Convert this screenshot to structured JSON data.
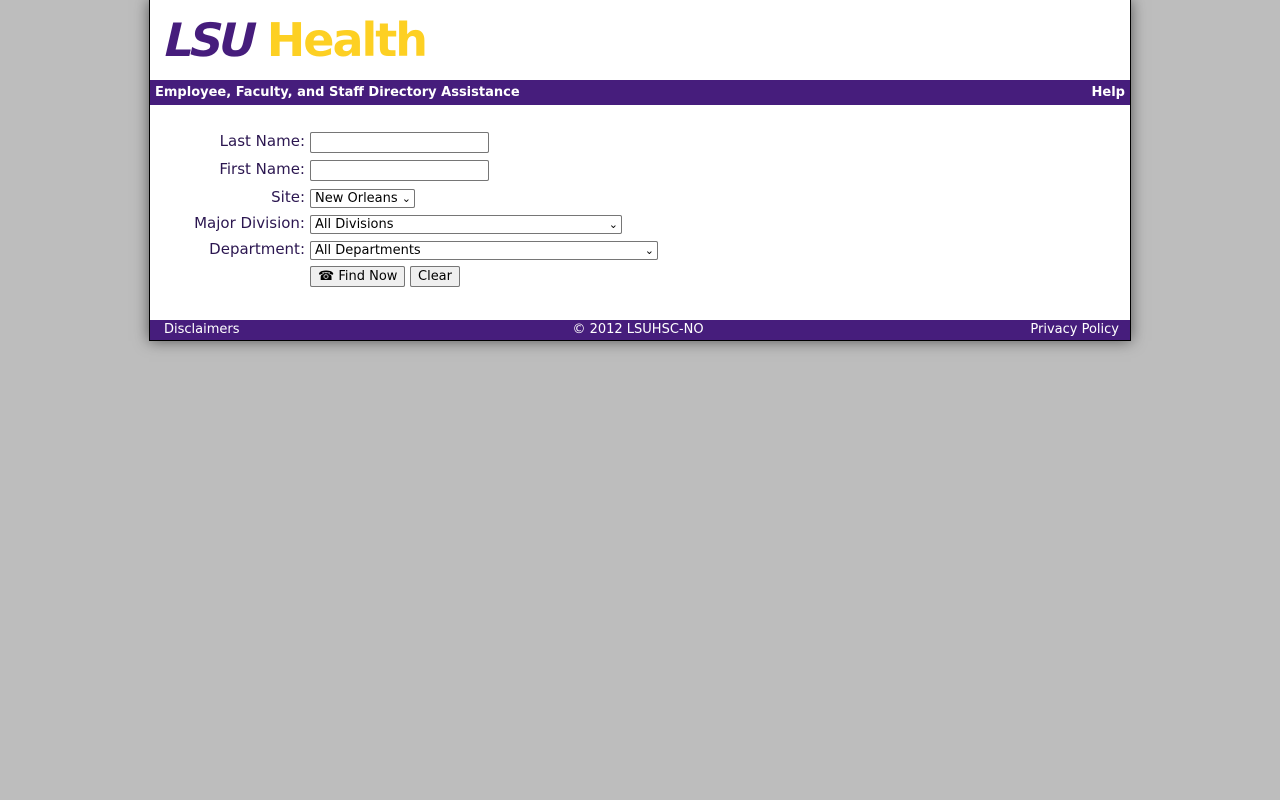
{
  "brand": {
    "logo_part1": "LSU",
    "logo_part2": "Health",
    "color_primary": "#461d7c",
    "color_accent": "#fdd023"
  },
  "header": {
    "title": "Employee, Faculty, and Staff Directory Assistance",
    "help_link": "Help"
  },
  "form": {
    "last_name": {
      "label": "Last Name:",
      "value": ""
    },
    "first_name": {
      "label": "First Name:",
      "value": ""
    },
    "site": {
      "label": "Site:",
      "selected": "New Orleans"
    },
    "major_division": {
      "label": "Major Division:",
      "selected": "All Divisions"
    },
    "department": {
      "label": "Department:",
      "selected": "All Departments"
    },
    "find_button": "☎ Find Now",
    "clear_button": "Clear"
  },
  "footer": {
    "disclaimers": "Disclaimers",
    "copyright": "© 2012 LSUHSC-NO",
    "privacy": "Privacy Policy"
  },
  "icons": {
    "find": "phone-icon",
    "dropdown": "chevron-down-icon"
  }
}
